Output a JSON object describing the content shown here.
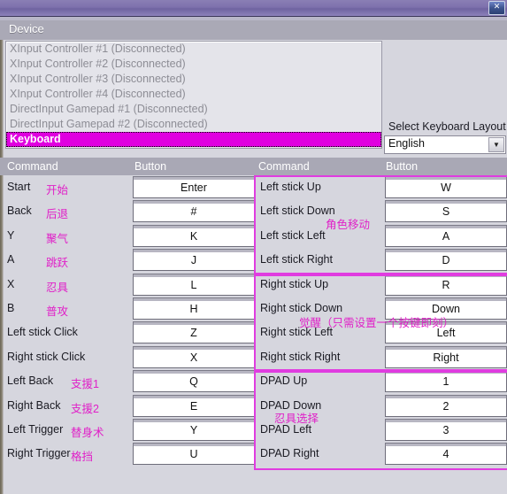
{
  "window": {
    "close_label": "✕"
  },
  "device": {
    "group_label": "Device",
    "items": [
      {
        "label": "XInput Controller #1 (Disconnected)",
        "selected": false
      },
      {
        "label": "XInput Controller #2 (Disconnected)",
        "selected": false
      },
      {
        "label": "XInput Controller #3 (Disconnected)",
        "selected": false
      },
      {
        "label": "XInput Controller #4 (Disconnected)",
        "selected": false
      },
      {
        "label": "DirectInput Gamepad #1 (Disconnected)",
        "selected": false
      },
      {
        "label": "DirectInput Gamepad #2 (Disconnected)",
        "selected": false
      },
      {
        "label": "Keyboard",
        "selected": true
      }
    ]
  },
  "keyboard_layout": {
    "label": "Select Keyboard Layout",
    "value": "English",
    "arrow": "▼"
  },
  "headers": {
    "command_left": "Command",
    "button_left": "Button",
    "command_right": "Command",
    "button_right": "Button"
  },
  "colors": {
    "accent_magenta": "#e020c8",
    "group_outline": "#e03ce0",
    "selection": "#e000e0",
    "header_bar": "#a9a8b5",
    "panel_bg": "#d6d6de"
  },
  "left_column": [
    {
      "command": "Start",
      "note": "开始",
      "button": "Enter"
    },
    {
      "command": "Back",
      "note": "后退",
      "button": "#"
    },
    {
      "command": "Y",
      "note": "聚气",
      "button": "K"
    },
    {
      "command": "A",
      "note": "跳跃",
      "button": "J"
    },
    {
      "command": "X",
      "note": "忍具",
      "button": "L"
    },
    {
      "command": "B",
      "note": "普攻",
      "button": "H"
    },
    {
      "command": "Left stick Click",
      "note": "",
      "button": "Z"
    },
    {
      "command": "Right stick Click",
      "note": "",
      "button": "X"
    },
    {
      "command": "Left Back",
      "note": "支援1",
      "button": "Q"
    },
    {
      "command": "Right Back",
      "note": "支援2",
      "button": "E"
    },
    {
      "command": "Left Trigger",
      "note": "替身术",
      "button": "Y"
    },
    {
      "command": "Right Trigger",
      "note": "格挡",
      "button": "U"
    }
  ],
  "right_column": [
    {
      "command": "Left stick Up",
      "button": "W"
    },
    {
      "command": "Left stick Down",
      "button": "S"
    },
    {
      "command": "Left stick Left",
      "button": "A"
    },
    {
      "command": "Left stick Right",
      "button": "D"
    },
    {
      "command": "Right stick Up",
      "button": "R"
    },
    {
      "command": "Right stick Down",
      "button": "Down"
    },
    {
      "command": "Right stick Left",
      "button": "Left"
    },
    {
      "command": "Right stick Right",
      "button": "Right"
    },
    {
      "command": "DPAD Up",
      "button": "1"
    },
    {
      "command": "DPAD Down",
      "button": "2"
    },
    {
      "command": "DPAD Left",
      "button": "3"
    },
    {
      "command": "DPAD Right",
      "button": "4"
    }
  ],
  "annotations": {
    "left_stick_group": "角色移动",
    "right_stick_group": "觉醒（只需设置一个按键即刻）",
    "dpad_group": "忍具选择"
  }
}
